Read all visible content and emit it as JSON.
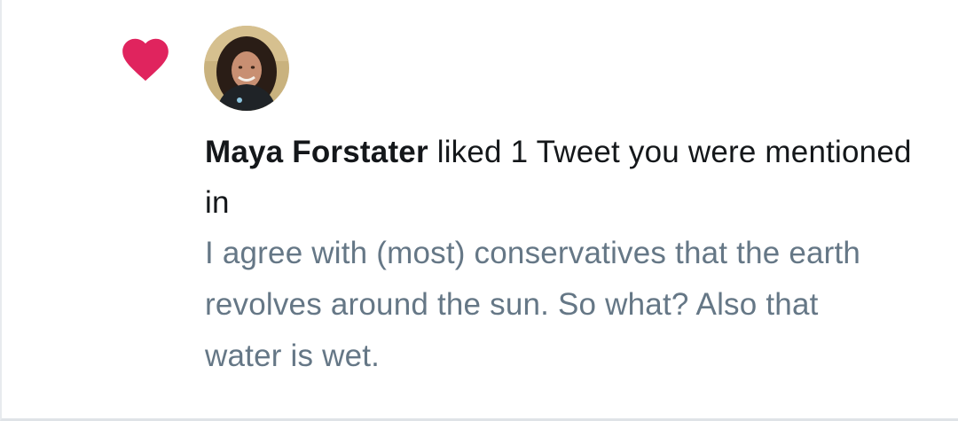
{
  "notification": {
    "icon": "heart-icon",
    "icon_color": "#e0245e",
    "user_name": "Maya Forstater",
    "action_text": " liked 1 Tweet you were mentioned in",
    "tweet_text": "I agree with (most) conservatives that the earth revolves around the sun. So what? Also that water is wet.",
    "text_color": "#14171a",
    "secondary_text_color": "#657786"
  }
}
